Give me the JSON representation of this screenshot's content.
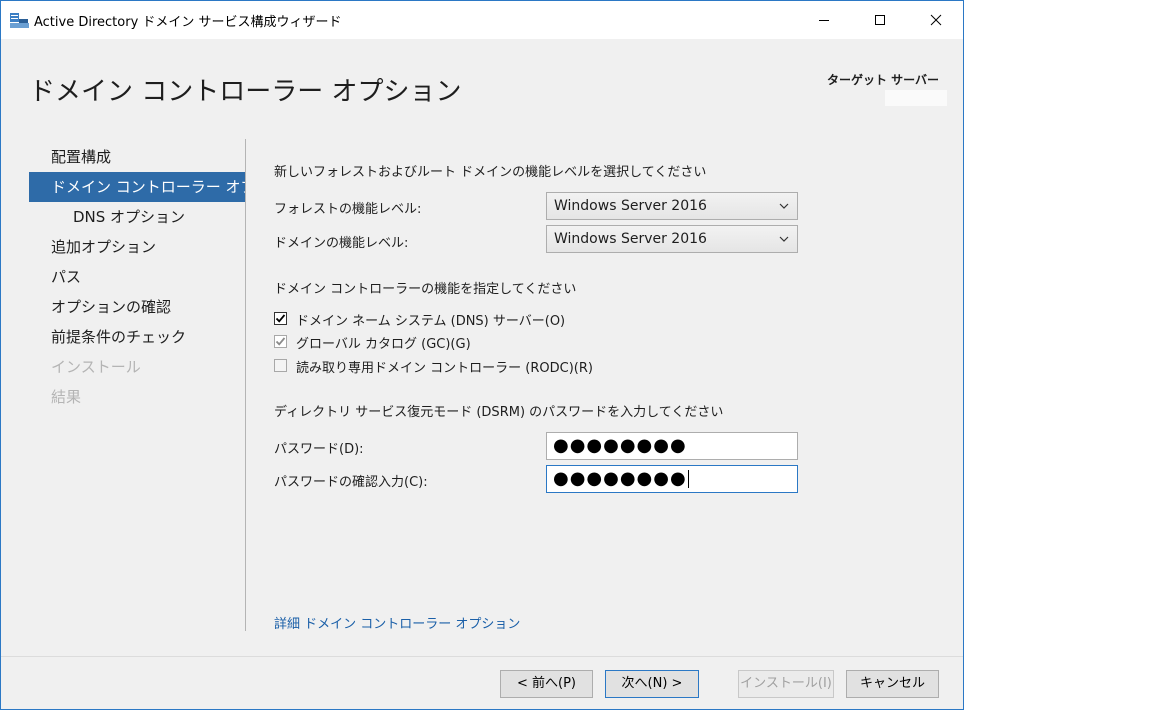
{
  "window": {
    "title": "Active Directory ドメイン サービス構成ウィザード",
    "minimize_icon": "minimize-icon",
    "maximize_icon": "maximize-icon",
    "close_icon": "close-icon",
    "border_color": "#2b78c5"
  },
  "header": {
    "title": "ドメイン コントローラー オプション",
    "target_server_label": "ターゲット サーバー"
  },
  "nav": {
    "items": [
      {
        "label": "配置構成",
        "state": "normal"
      },
      {
        "label": "ドメイン コントローラー オプシ...",
        "state": "active"
      },
      {
        "label": "DNS オプション",
        "state": "sub"
      },
      {
        "label": "追加オプション",
        "state": "normal"
      },
      {
        "label": "パス",
        "state": "normal"
      },
      {
        "label": "オプションの確認",
        "state": "normal"
      },
      {
        "label": "前提条件のチェック",
        "state": "normal"
      },
      {
        "label": "インストール",
        "state": "disabled"
      },
      {
        "label": "結果",
        "state": "disabled"
      }
    ],
    "active_color": "#2e6ba8"
  },
  "main": {
    "func_level_heading": "新しいフォレストおよびルート ドメインの機能レベルを選択してください",
    "forest_level_label": "フォレストの機能レベル:",
    "forest_level_value": "Windows Server 2016",
    "domain_level_label": "ドメインの機能レベル:",
    "domain_level_value": "Windows Server 2016",
    "dc_caps_heading": "ドメイン コントローラーの機能を指定してください",
    "checkboxes": [
      {
        "label": "ドメイン ネーム システム (DNS) サーバー(O)",
        "checked": true,
        "enabled": true
      },
      {
        "label": "グローバル カタログ (GC)(G)",
        "checked": true,
        "enabled": false
      },
      {
        "label": "読み取り専用ドメイン コントローラー (RODC)(R)",
        "checked": false,
        "enabled": false
      }
    ],
    "dsrm_heading": "ディレクトリ サービス復元モード (DSRM) のパスワードを入力してください",
    "password_label": "パスワード(D):",
    "password_value": "●●●●●●●●",
    "confirm_label": "パスワードの確認入力(C):",
    "confirm_value": "●●●●●●●●",
    "more_link": "詳細 ドメイン コントローラー オプション",
    "link_color": "#1a5fa8"
  },
  "footer": {
    "prev_label": "< 前へ(P)",
    "next_label": "次へ(N) >",
    "install_label": "インストール(I)",
    "cancel_label": "キャンセル"
  }
}
